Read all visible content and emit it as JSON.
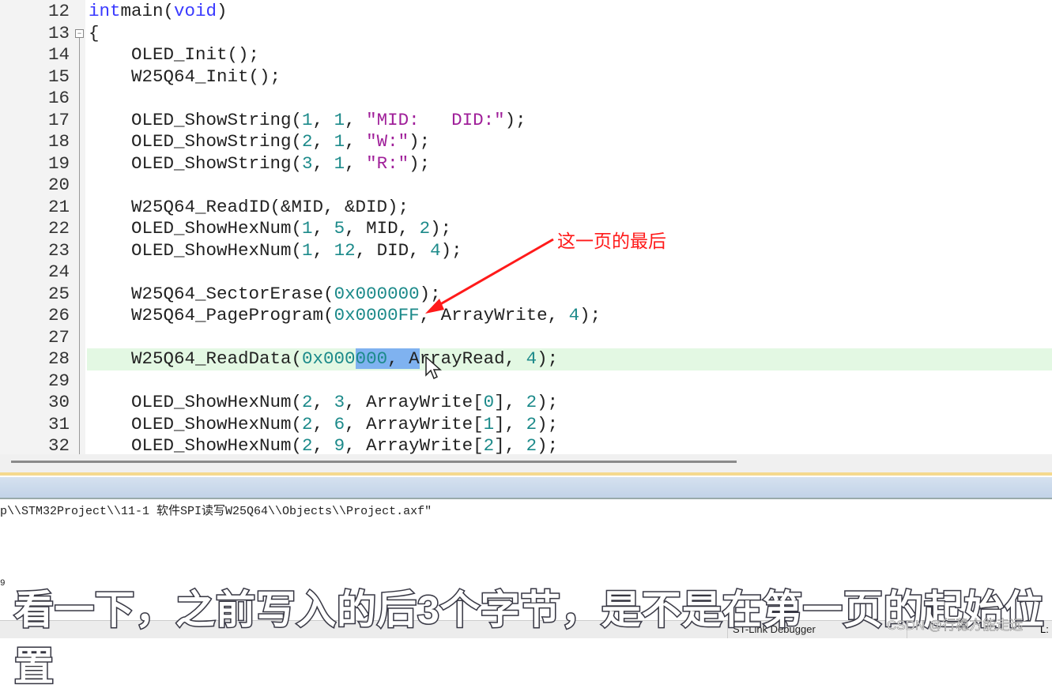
{
  "editor": {
    "lines": [
      {
        "n": "12",
        "t": [
          [
            "kw",
            "int"
          ],
          [
            "",
            "main("
          ],
          [
            "kw",
            "void"
          ],
          [
            "",
            ")"
          ]
        ]
      },
      {
        "n": "13",
        "t": [
          [
            "",
            "{"
          ]
        ]
      },
      {
        "n": "14",
        "t": [
          [
            "",
            "    OLED_Init();"
          ]
        ]
      },
      {
        "n": "15",
        "t": [
          [
            "",
            "    W25Q64_Init();"
          ]
        ]
      },
      {
        "n": "16",
        "t": []
      },
      {
        "n": "17",
        "t": [
          [
            "",
            "    OLED_ShowString("
          ],
          [
            "num",
            "1"
          ],
          [
            "",
            ", "
          ],
          [
            "num",
            "1"
          ],
          [
            "",
            ", "
          ],
          [
            "str",
            "\"MID:   DID:\""
          ],
          [
            "",
            ");"
          ]
        ]
      },
      {
        "n": "18",
        "t": [
          [
            "",
            "    OLED_ShowString("
          ],
          [
            "num",
            "2"
          ],
          [
            "",
            ", "
          ],
          [
            "num",
            "1"
          ],
          [
            "",
            ", "
          ],
          [
            "str",
            "\"W:\""
          ],
          [
            "",
            ");"
          ]
        ]
      },
      {
        "n": "19",
        "t": [
          [
            "",
            "    OLED_ShowString("
          ],
          [
            "num",
            "3"
          ],
          [
            "",
            ", "
          ],
          [
            "num",
            "1"
          ],
          [
            "",
            ", "
          ],
          [
            "str",
            "\"R:\""
          ],
          [
            "",
            ");"
          ]
        ]
      },
      {
        "n": "20",
        "t": []
      },
      {
        "n": "21",
        "t": [
          [
            "",
            "    W25Q64_ReadID(&MID, &DID);"
          ]
        ]
      },
      {
        "n": "22",
        "t": [
          [
            "",
            "    OLED_ShowHexNum("
          ],
          [
            "num",
            "1"
          ],
          [
            "",
            ", "
          ],
          [
            "num",
            "5"
          ],
          [
            "",
            ", MID, "
          ],
          [
            "num",
            "2"
          ],
          [
            "",
            ");"
          ]
        ]
      },
      {
        "n": "23",
        "t": [
          [
            "",
            "    OLED_ShowHexNum("
          ],
          [
            "num",
            "1"
          ],
          [
            "",
            ", "
          ],
          [
            "num",
            "12"
          ],
          [
            "",
            ", DID, "
          ],
          [
            "num",
            "4"
          ],
          [
            "",
            ");"
          ]
        ]
      },
      {
        "n": "24",
        "t": []
      },
      {
        "n": "25",
        "t": [
          [
            "",
            "    W25Q64_SectorErase("
          ],
          [
            "num",
            "0x000000"
          ],
          [
            "",
            ");"
          ]
        ]
      },
      {
        "n": "26",
        "t": [
          [
            "",
            "    W25Q64_PageProgram("
          ],
          [
            "num",
            "0x0000FF"
          ],
          [
            "",
            ", ArrayWrite, "
          ],
          [
            "num",
            "4"
          ],
          [
            "",
            ");"
          ]
        ]
      },
      {
        "n": "27",
        "t": []
      },
      {
        "n": "28",
        "hl": true,
        "t": [
          [
            "",
            "    W25Q64_ReadData("
          ],
          [
            "num",
            "0x000"
          ],
          [
            "num sel",
            "000"
          ],
          [
            "sel",
            ", A"
          ],
          [
            "",
            "rrayRead, "
          ],
          [
            "num",
            "4"
          ],
          [
            "",
            ");"
          ]
        ]
      },
      {
        "n": "29",
        "t": []
      },
      {
        "n": "30",
        "t": [
          [
            "",
            "    OLED_ShowHexNum("
          ],
          [
            "num",
            "2"
          ],
          [
            "",
            ", "
          ],
          [
            "num",
            "3"
          ],
          [
            "",
            ", ArrayWrite["
          ],
          [
            "num",
            "0"
          ],
          [
            "",
            "], "
          ],
          [
            "num",
            "2"
          ],
          [
            "",
            ");"
          ]
        ]
      },
      {
        "n": "31",
        "t": [
          [
            "",
            "    OLED_ShowHexNum("
          ],
          [
            "num",
            "2"
          ],
          [
            "",
            ", "
          ],
          [
            "num",
            "6"
          ],
          [
            "",
            ", ArrayWrite["
          ],
          [
            "num",
            "1"
          ],
          [
            "",
            "], "
          ],
          [
            "num",
            "2"
          ],
          [
            "",
            ");"
          ]
        ]
      },
      {
        "n": "32",
        "t": [
          [
            "",
            "    OLED_ShowHexNum("
          ],
          [
            "num",
            "2"
          ],
          [
            "",
            ", "
          ],
          [
            "num",
            "9"
          ],
          [
            "",
            ", ArrayWrite["
          ],
          [
            "num",
            "2"
          ],
          [
            "",
            "], "
          ],
          [
            "num",
            "2"
          ],
          [
            "",
            ");"
          ]
        ]
      }
    ]
  },
  "annotation": {
    "text": "这一页的最后",
    "color": "#ff1a1a"
  },
  "output": {
    "line1": "p\\\\STM32Project\\\\11-1 软件SPI读写W25Q64\\\\Objects\\\\Project.axf\"",
    "line2": "9"
  },
  "status": {
    "debugger": "ST-Link Debugger",
    "position": "L:"
  },
  "subtitle": "看一下，之前写入的后3个字节，是不是在第一页的起始位置",
  "watermark": "CSDN @行稳方能走远",
  "colors": {
    "keyword": "#3a3aff",
    "number": "#1c8a8a",
    "string": "#a0209a",
    "highlight_line": "#e3f8e3",
    "selection": "#7fb2f0"
  }
}
